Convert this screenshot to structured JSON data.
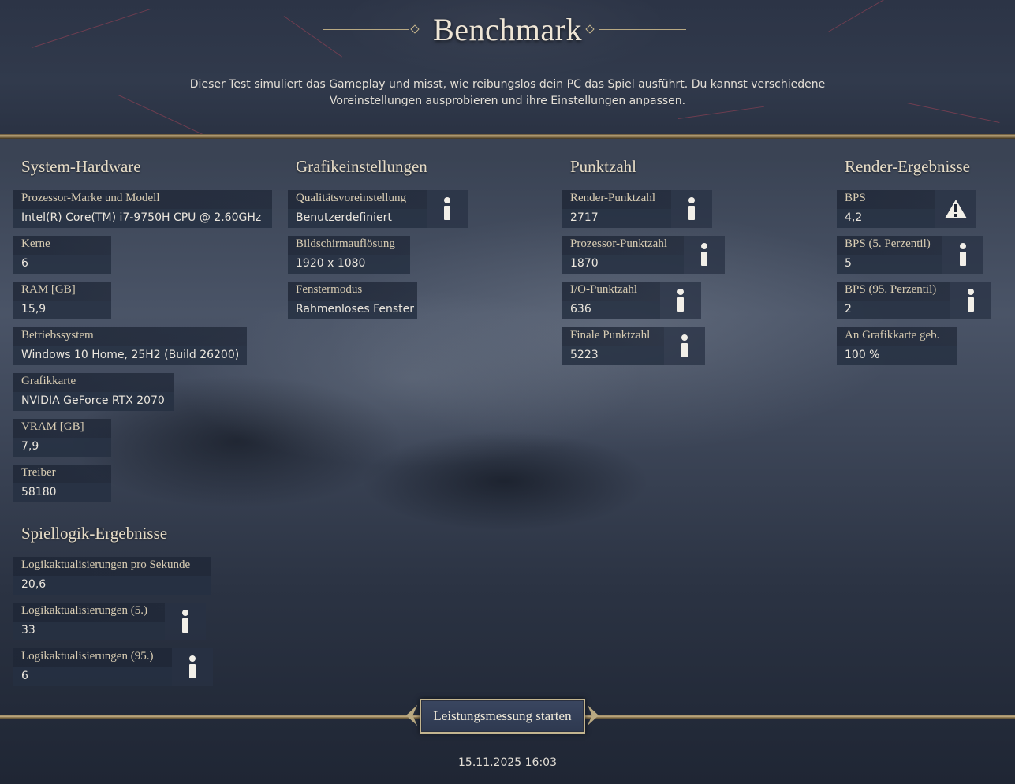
{
  "header": {
    "title": "Benchmark",
    "description_line1": "Dieser Test simuliert das Gameplay und misst, wie reibungslos dein PC das Spiel ausführt. Du kannst verschiedene",
    "description_line2": "Voreinstellungen ausprobieren und ihre Einstellungen anpassen."
  },
  "system_hardware": {
    "title": "System-Hardware",
    "fields": [
      {
        "label": "Prozessor-Marke und Modell",
        "value": "Intel(R) Core(TM) i7-9750H CPU @ 2.60GHz"
      },
      {
        "label": "Kerne",
        "value": "6"
      },
      {
        "label": "RAM [GB]",
        "value": "15,9"
      },
      {
        "label": "Betriebssystem",
        "value": "Windows 10 Home, 25H2 (Build 26200)"
      },
      {
        "label": "Grafikkarte",
        "value": "NVIDIA GeForce RTX 2070"
      },
      {
        "label": "VRAM [GB]",
        "value": "7,9"
      },
      {
        "label": "Treiber",
        "value": "58180"
      }
    ]
  },
  "graphics_settings": {
    "title": "Grafikeinstellungen",
    "fields": [
      {
        "label": "Qualitätsvoreinstellung",
        "value": "Benutzerdefiniert",
        "icon": "info-icon"
      },
      {
        "label": "Bildschirmauflösung",
        "value": "1920 x 1080"
      },
      {
        "label": "Fenstermodus",
        "value": "Rahmenloses Fenster"
      }
    ]
  },
  "score": {
    "title": "Punktzahl",
    "fields": [
      {
        "label": "Render-Punktzahl",
        "value": "2717",
        "icon": "info-icon"
      },
      {
        "label": "Prozessor-Punktzahl",
        "value": "1870",
        "icon": "info-icon"
      },
      {
        "label": "I/O-Punktzahl",
        "value": "636",
        "icon": "info-icon"
      },
      {
        "label": "Finale Punktzahl",
        "value": "5223",
        "icon": "info-icon"
      }
    ]
  },
  "render_results": {
    "title": "Render-Ergebnisse",
    "fields": [
      {
        "label": "BPS",
        "value": "4,2",
        "icon": "warning-icon"
      },
      {
        "label": "BPS (5. Perzentil)",
        "value": "5",
        "icon": "info-icon"
      },
      {
        "label": "BPS (95. Perzentil)",
        "value": "2",
        "icon": "info-icon"
      },
      {
        "label": "An Grafikkarte geb.",
        "value": "100 %"
      }
    ]
  },
  "game_logic": {
    "title": "Spiellogik-Ergebnisse",
    "fields": [
      {
        "label": "Logikaktualisierungen pro Sekunde",
        "value": "20,6"
      },
      {
        "label": "Logikaktualisierungen (5.)",
        "value": "33",
        "icon": "info-icon"
      },
      {
        "label": "Logikaktualisierungen (95.)",
        "value": "6",
        "icon": "info-icon"
      }
    ]
  },
  "footer": {
    "start_button": "Leistungsmessung starten",
    "timestamp": "15.11.2025 16:03"
  }
}
